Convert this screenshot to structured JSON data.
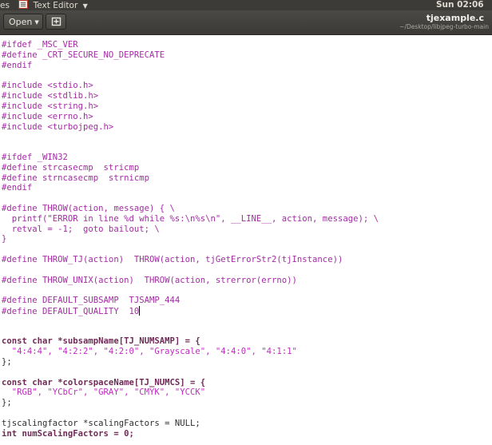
{
  "topbar": {
    "left_text": "es",
    "app_name": "Text Editor",
    "app_caret": "▼",
    "clock": "Sun 02:06"
  },
  "header": {
    "open_label": "Open",
    "open_arrow": "▼",
    "title": "tjexample.c",
    "path": "~/Desktop/libjpeg-turbo-main"
  },
  "editor": {
    "lines": [
      "#ifdef _MSC_VER",
      "#define _CRT_SECURE_NO_DEPRECATE",
      "#endif",
      "",
      "#include <stdio.h>",
      "#include <stdlib.h>",
      "#include <string.h>",
      "#include <errno.h>",
      "#include <turbojpeg.h>",
      "",
      "",
      "#ifdef _WIN32",
      "#define strcasecmp  stricmp",
      "#define strncasecmp  strnicmp",
      "#endif",
      "",
      "#define THROW(action, message) { \\",
      "  printf(\"ERROR in line %d while %s:\\n%s\\n\", __LINE__, action, message); \\",
      "  retval = -1;  goto bailout; \\",
      "}",
      "",
      "#define THROW_TJ(action)  THROW(action, tjGetErrorStr2(tjInstance))",
      "",
      "#define THROW_UNIX(action)  THROW(action, strerror(errno))",
      "",
      "#define DEFAULT_SUBSAMP  TJSAMP_444",
      "#define DEFAULT_QUALITY  10",
      "",
      "",
      "const char *subsampName[TJ_NUMSAMP] = {",
      "  \"4:4:4\", \"4:2:2\", \"4:2:0\", \"Grayscale\", \"4:4:0\", \"4:1:1\"",
      "};",
      "",
      "const char *colorspaceName[TJ_NUMCS] = {",
      "  \"RGB\", \"YCbCr\", \"GRAY\", \"CMYK\", \"YCCK\"",
      "};",
      "",
      "tjscalingfactor *scalingFactors = NULL;",
      "int numScalingFactors = 0;"
    ]
  }
}
